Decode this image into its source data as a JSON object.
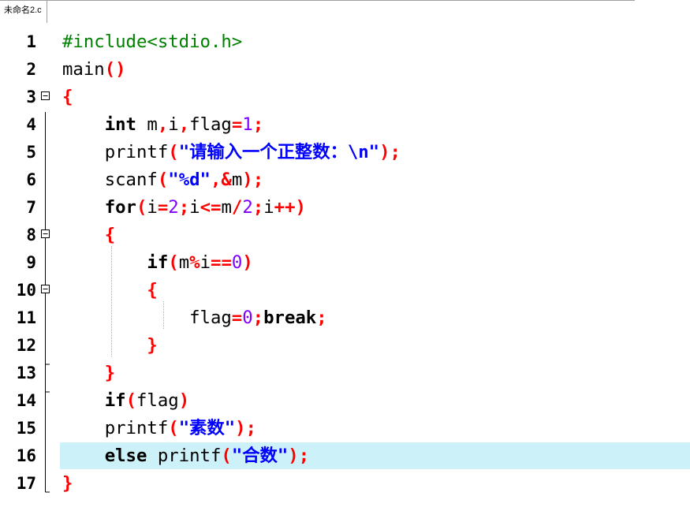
{
  "tab": {
    "title": "未命名2.c"
  },
  "lines": [
    {
      "n": "1"
    },
    {
      "n": "2"
    },
    {
      "n": "3"
    },
    {
      "n": "4"
    },
    {
      "n": "5"
    },
    {
      "n": "6"
    },
    {
      "n": "7"
    },
    {
      "n": "8"
    },
    {
      "n": "9"
    },
    {
      "n": "10"
    },
    {
      "n": "11"
    },
    {
      "n": "12"
    },
    {
      "n": "13"
    },
    {
      "n": "14"
    },
    {
      "n": "15"
    },
    {
      "n": "16"
    },
    {
      "n": "17"
    }
  ],
  "code": {
    "l1": {
      "a": "#include<stdio.h>"
    },
    "l2": {
      "a": "main",
      "b": "()"
    },
    "l3": {
      "a": "{"
    },
    "l4": {
      "a": "int",
      "b": " m",
      "c": ",",
      "d": "i",
      "e": ",",
      "f": "flag",
      "g": "=",
      "h": "1",
      "i": ";"
    },
    "l5": {
      "a": "printf",
      "b": "(",
      "c": "\"",
      "d": "请输入一个正整数：",
      "e": "\\n\"",
      "f": ");"
    },
    "l6": {
      "a": "scanf",
      "b": "(",
      "c": "\"%d\"",
      "d": ",&",
      "e": "m",
      "f": ");"
    },
    "l7": {
      "a": "for",
      "b": "(",
      "c": "i",
      "d": "=",
      "e": "2",
      "f": ";",
      "g": "i",
      "h": "<=",
      "i": "m",
      "j": "/",
      "k": "2",
      "l": ";",
      "m": "i",
      "n": "++)"
    },
    "l8": {
      "a": "{"
    },
    "l9": {
      "a": "if",
      "b": "(",
      "c": "m",
      "d": "%",
      "e": "i",
      "f": "==",
      "g": "0",
      "h": ")"
    },
    "l10": {
      "a": "{"
    },
    "l11": {
      "a": "flag",
      "b": "=",
      "c": "0",
      "d": ";",
      "e": "break",
      "f": ";"
    },
    "l12": {
      "a": "}"
    },
    "l13": {
      "a": "}"
    },
    "l14": {
      "a": "if",
      "b": "(",
      "c": "flag",
      "d": ")"
    },
    "l15": {
      "a": "printf",
      "b": "(",
      "c": "\"",
      "d": "素数",
      "e": "\"",
      "f": ");"
    },
    "l16": {
      "a": "else",
      "b": " printf",
      "c": "(",
      "d": "\"",
      "e": "合数",
      "f": "\"",
      "g": ");"
    },
    "l17": {
      "a": "}"
    }
  },
  "colors": {
    "keyword": "#000000",
    "preprocessor": "#008000",
    "operator": "#ff0000",
    "number": "#8000ff",
    "string": "#0000ff",
    "current_line": "#cdf1f8"
  }
}
